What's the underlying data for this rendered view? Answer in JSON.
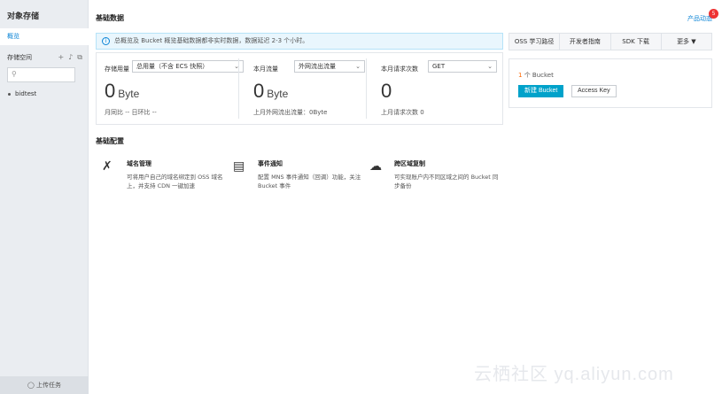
{
  "sidebar": {
    "title": "对象存储",
    "nav_overview": "概览",
    "section_label": "存储空间",
    "tools": [
      "+",
      "♪",
      "⧉"
    ],
    "buckets": [
      "bidtest"
    ],
    "footer": "上传任务"
  },
  "main": {
    "title": "基础数据",
    "news_link": "产品动态",
    "news_badge": "5",
    "notice": "总概览及 Bucket 概览基础数据都非实时数据，数据延迟 2-3 个小时。"
  },
  "stats": [
    {
      "label": "存储用量",
      "select": "总用量（不含 ECS 快照）",
      "value": "0",
      "unit": "Byte",
      "sub": "月同比 -- 日环比 --"
    },
    {
      "label": "本月流量",
      "select": "外网流出流量",
      "value": "0",
      "unit": "Byte",
      "sub": "上月外网流出流量：0Byte"
    },
    {
      "label": "本月请求次数",
      "select": "GET",
      "value": "0",
      "unit": "",
      "sub": "上月请求次数 0"
    }
  ],
  "tabs": [
    "OSS 学习路径",
    "开发者指南",
    "SDK 下载",
    "更多 ▼"
  ],
  "bucket_panel": {
    "count_num": "1",
    "count_text": " 个 Bucket",
    "new_button": "新建 Bucket",
    "key_button": "Access Key"
  },
  "config": {
    "title": "基础配置",
    "items": [
      {
        "icon": "domain-icon",
        "title": "域名管理",
        "desc": "可将用户自己的域名绑定到 OSS 域名上，并支持 CDN 一键加速"
      },
      {
        "icon": "event-icon",
        "title": "事件通知",
        "desc": "配置 MNS 事件通知（回调）功能，关注 Bucket 事件"
      },
      {
        "icon": "replication-icon",
        "title": "跨区域复制",
        "desc": "可实现账户内不同区域之间的 Bucket 同步备份"
      }
    ]
  },
  "watermark": "云栖社区 yq.aliyun.com"
}
